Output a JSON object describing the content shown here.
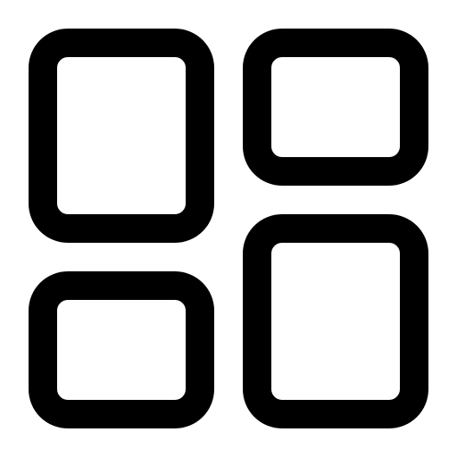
{
  "icon": {
    "semantic_name": "dashboard-layout-icon",
    "stroke_color": "#000000",
    "background_color": "#ffffff",
    "panels": [
      {
        "name": "tall-top-left"
      },
      {
        "name": "wide-top-right"
      },
      {
        "name": "wide-bottom-left"
      },
      {
        "name": "tall-bottom-right"
      }
    ]
  }
}
